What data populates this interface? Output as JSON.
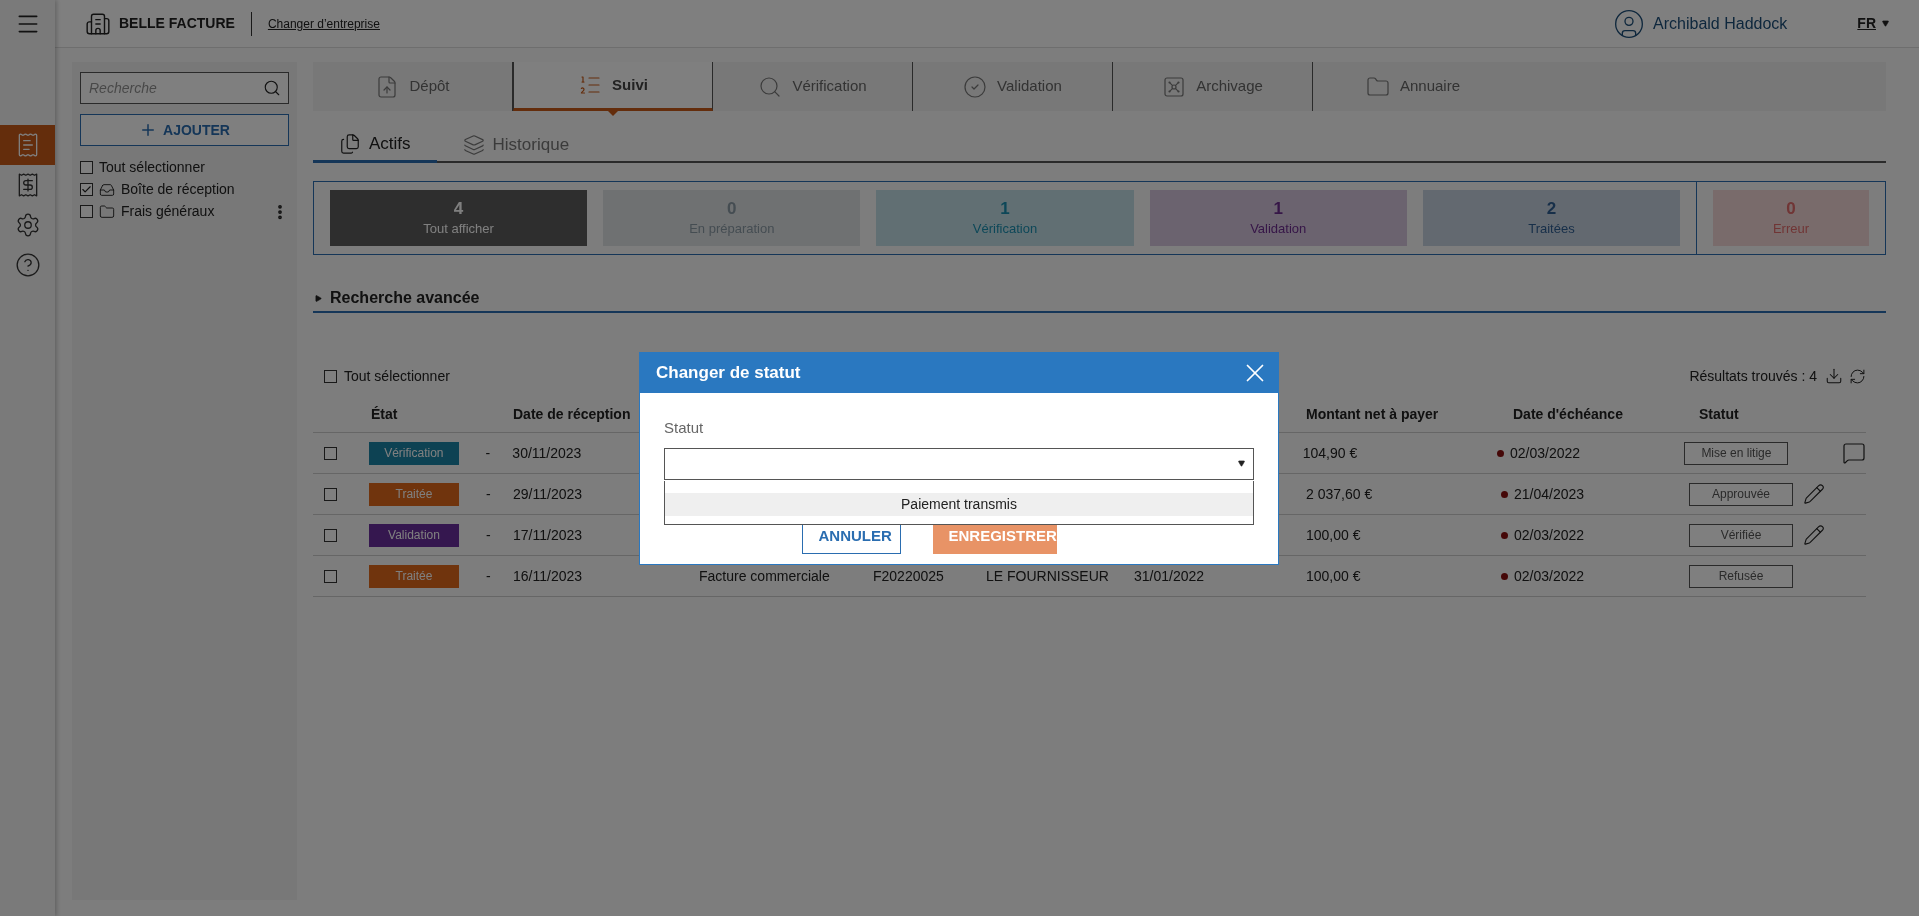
{
  "topbar": {
    "company": "BELLE FACTURE",
    "switch_link": "Changer d’entreprise",
    "user": "Archibald Haddock",
    "language": "FR"
  },
  "rail": [
    {
      "kind": "receipt",
      "selected": true
    },
    {
      "kind": "invoice",
      "selected": false
    },
    {
      "kind": "settings",
      "selected": false
    },
    {
      "kind": "help",
      "selected": false
    }
  ],
  "sidebar": {
    "search": {
      "placeholder": "Recherche"
    },
    "add_button": "AJOUTER",
    "tree": [
      {
        "label": "Tout sélectionner",
        "checked": false,
        "kind": "plain"
      },
      {
        "label": "Boîte de réception",
        "checked": true,
        "kind": "inbox"
      },
      {
        "label": "Frais généraux",
        "checked": false,
        "kind": "folder"
      }
    ]
  },
  "tabs": [
    {
      "label": "Dépôt",
      "kind": "upload",
      "selected": false
    },
    {
      "label": "Suivi",
      "kind": "list",
      "selected": true
    },
    {
      "label": "Vérification",
      "kind": "search",
      "selected": false
    },
    {
      "label": "Validation",
      "kind": "check",
      "selected": false
    },
    {
      "label": "Archivage",
      "kind": "vault",
      "selected": false
    },
    {
      "label": "Annuaire",
      "kind": "folder",
      "selected": false
    }
  ],
  "subtabs": [
    {
      "label": "Actifs",
      "kind": "files",
      "selected": true
    },
    {
      "label": "Historique",
      "kind": "stack",
      "selected": false
    }
  ],
  "stats": [
    {
      "count": "4",
      "label": "Tout afficher",
      "kind": "all",
      "selected": true
    },
    {
      "count": "0",
      "label": "En préparation",
      "kind": "draft",
      "selected": false
    },
    {
      "count": "1",
      "label": "Vérification",
      "kind": "verification",
      "selected": false
    },
    {
      "count": "1",
      "label": "Validation",
      "kind": "validation",
      "selected": false
    },
    {
      "count": "2",
      "label": "Traitées",
      "kind": "processed",
      "selected": false
    }
  ],
  "error_stat": {
    "count": "0",
    "label": "Erreur",
    "kind": "error",
    "selected": false
  },
  "advanced_search": {
    "label": "Recherche avancée",
    "expanded": false
  },
  "table": {
    "select_all": {
      "label": "Tout sélectionner",
      "checked": false
    },
    "results": "Résultats trouvés : 4",
    "columns": {
      "state": "État",
      "received": "Date de réception",
      "amount": "Montant net à payer",
      "due": "Date d'échéance",
      "status": "Statut"
    },
    "rows": [
      {
        "checked": false,
        "state": {
          "label": "Vérification",
          "kind": "verification"
        },
        "dash": "-",
        "received": "30/11/2023",
        "amount": "104,90 €",
        "due": "02/03/2022",
        "status": "Mise en litige",
        "kind": "comment"
      },
      {
        "checked": false,
        "state": {
          "label": "Traitée",
          "kind": "processed"
        },
        "dash": "-",
        "received": "29/11/2023",
        "amount": "2 037,60 €",
        "due": "21/04/2023",
        "status": "Approuvée",
        "kind": "edit"
      },
      {
        "checked": false,
        "state": {
          "label": "Validation",
          "kind": "validation"
        },
        "dash": "-",
        "received": "17/11/2023",
        "amount": "100,00 €",
        "due": "02/03/2022",
        "status": "Vérifiée",
        "kind": "edit"
      },
      {
        "checked": false,
        "state": {
          "label": "Traitée",
          "kind": "processed"
        },
        "dash": "-",
        "received": "16/11/2023",
        "type": "Facture commerciale",
        "number": "F20220025",
        "supplier": "LE FOURNISSEUR",
        "date": "31/01/2022",
        "amount": "100,00 €",
        "due": "02/03/2022",
        "status": "Refusée"
      }
    ]
  },
  "modal": {
    "title": "Changer de statut",
    "field_label": "Statut",
    "options": [
      {
        "label": "Paiement transmis",
        "selected": true
      }
    ],
    "buttons": [
      {
        "label": "ANNULER",
        "kind": "secondary"
      },
      {
        "label": "ENREGISTRER",
        "kind": "primary"
      }
    ]
  }
}
